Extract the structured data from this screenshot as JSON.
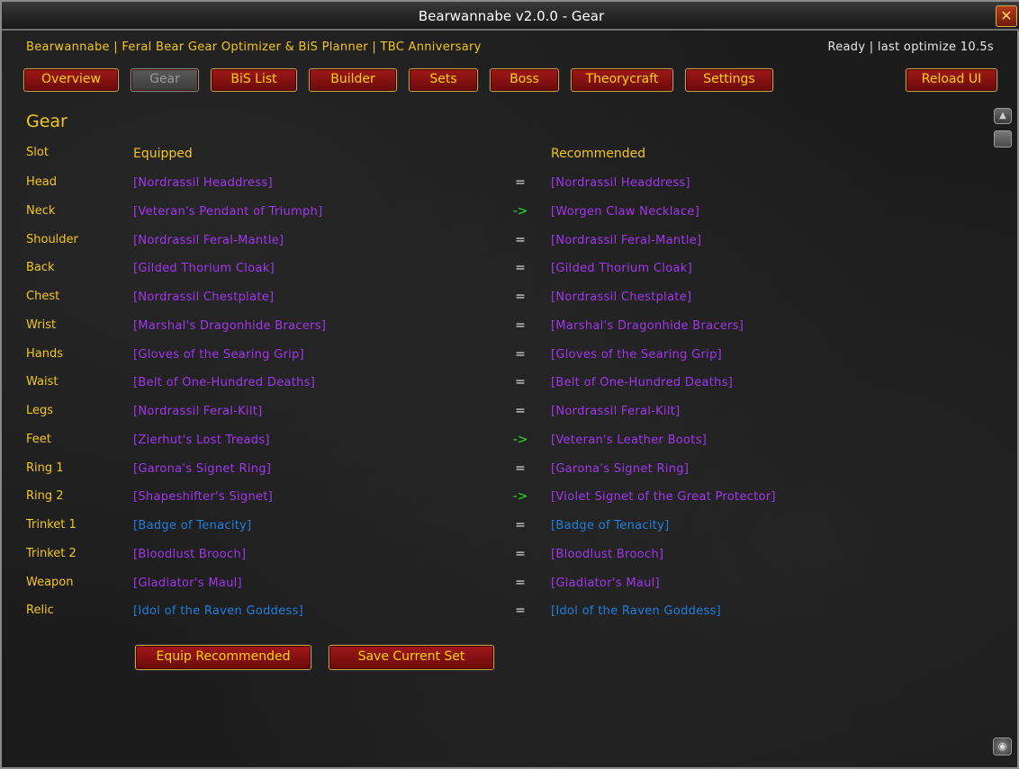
{
  "window": {
    "title": "Bearwannabe v2.0.0  -  Gear"
  },
  "header": {
    "subtitle": "Bearwannabe | Feral Bear Gear Optimizer & BiS Planner | TBC Anniversary",
    "status": "Ready | last optimize 10.5s"
  },
  "tabs": [
    {
      "label": "Overview",
      "active": false
    },
    {
      "label": "Gear",
      "active": true
    },
    {
      "label": "BiS List",
      "active": false
    },
    {
      "label": "Builder",
      "active": false
    },
    {
      "label": "Sets",
      "active": false
    },
    {
      "label": "Boss",
      "active": false
    },
    {
      "label": "Theorycraft",
      "active": false
    },
    {
      "label": "Settings",
      "active": false
    }
  ],
  "reload_label": "Reload UI",
  "section_title": "Gear",
  "columns": {
    "slot": "Slot",
    "equipped": "Equipped",
    "recommended": "Recommended"
  },
  "colors": {
    "epic": "#a335ee",
    "rare": "#1e80dd",
    "upgrade": "#26e026",
    "gold": "#f4c61c"
  },
  "rows": [
    {
      "slot": "Head",
      "equipped": "[Nordrassil Headdress]",
      "sign": "=",
      "recommended": "[Nordrassil Headdress]",
      "equipped_quality": "epic",
      "recommended_quality": "epic"
    },
    {
      "slot": "Neck",
      "equipped": "[Veteran's Pendant of Triumph]",
      "sign": "->",
      "recommended": "[Worgen Claw Necklace]",
      "equipped_quality": "epic",
      "recommended_quality": "epic"
    },
    {
      "slot": "Shoulder",
      "equipped": "[Nordrassil Feral-Mantle]",
      "sign": "=",
      "recommended": "[Nordrassil Feral-Mantle]",
      "equipped_quality": "epic",
      "recommended_quality": "epic"
    },
    {
      "slot": "Back",
      "equipped": "[Gilded Thorium Cloak]",
      "sign": "=",
      "recommended": "[Gilded Thorium Cloak]",
      "equipped_quality": "epic",
      "recommended_quality": "epic"
    },
    {
      "slot": "Chest",
      "equipped": "[Nordrassil Chestplate]",
      "sign": "=",
      "recommended": "[Nordrassil Chestplate]",
      "equipped_quality": "epic",
      "recommended_quality": "epic"
    },
    {
      "slot": "Wrist",
      "equipped": "[Marshal's Dragonhide Bracers]",
      "sign": "=",
      "recommended": "[Marshal's Dragonhide Bracers]",
      "equipped_quality": "epic",
      "recommended_quality": "epic"
    },
    {
      "slot": "Hands",
      "equipped": "[Gloves of the Searing Grip]",
      "sign": "=",
      "recommended": "[Gloves of the Searing Grip]",
      "equipped_quality": "epic",
      "recommended_quality": "epic"
    },
    {
      "slot": "Waist",
      "equipped": "[Belt of One-Hundred Deaths]",
      "sign": "=",
      "recommended": "[Belt of One-Hundred Deaths]",
      "equipped_quality": "epic",
      "recommended_quality": "epic"
    },
    {
      "slot": "Legs",
      "equipped": "[Nordrassil Feral-Kilt]",
      "sign": "=",
      "recommended": "[Nordrassil Feral-Kilt]",
      "equipped_quality": "epic",
      "recommended_quality": "epic"
    },
    {
      "slot": "Feet",
      "equipped": "[Zierhut's Lost Treads]",
      "sign": "->",
      "recommended": "[Veteran's Leather Boots]",
      "equipped_quality": "epic",
      "recommended_quality": "epic"
    },
    {
      "slot": "Ring 1",
      "equipped": "[Garona's Signet Ring]",
      "sign": "=",
      "recommended": "[Garona's Signet Ring]",
      "equipped_quality": "epic",
      "recommended_quality": "epic"
    },
    {
      "slot": "Ring 2",
      "equipped": "[Shapeshifter's Signet]",
      "sign": "->",
      "recommended": "[Violet Signet of the Great Protector]",
      "equipped_quality": "epic",
      "recommended_quality": "epic"
    },
    {
      "slot": "Trinket 1",
      "equipped": "[Badge of Tenacity]",
      "sign": "=",
      "recommended": "[Badge of Tenacity]",
      "equipped_quality": "rare",
      "recommended_quality": "rare"
    },
    {
      "slot": "Trinket 2",
      "equipped": "[Bloodlust Brooch]",
      "sign": "=",
      "recommended": "[Bloodlust Brooch]",
      "equipped_quality": "epic",
      "recommended_quality": "epic"
    },
    {
      "slot": "Weapon",
      "equipped": "[Gladiator's Maul]",
      "sign": "=",
      "recommended": "[Gladiator's Maul]",
      "equipped_quality": "epic",
      "recommended_quality": "epic"
    },
    {
      "slot": "Relic",
      "equipped": "[Idol of the Raven Goddess]",
      "sign": "=",
      "recommended": "[Idol of the Raven Goddess]",
      "equipped_quality": "rare",
      "recommended_quality": "rare"
    }
  ],
  "actions": {
    "equip_label": "Equip Recommended",
    "save_label": "Save Current Set"
  },
  "icons": {
    "close": "close-icon",
    "scroll_up": "scroll-up-icon",
    "resize": "resize-grip-icon"
  }
}
